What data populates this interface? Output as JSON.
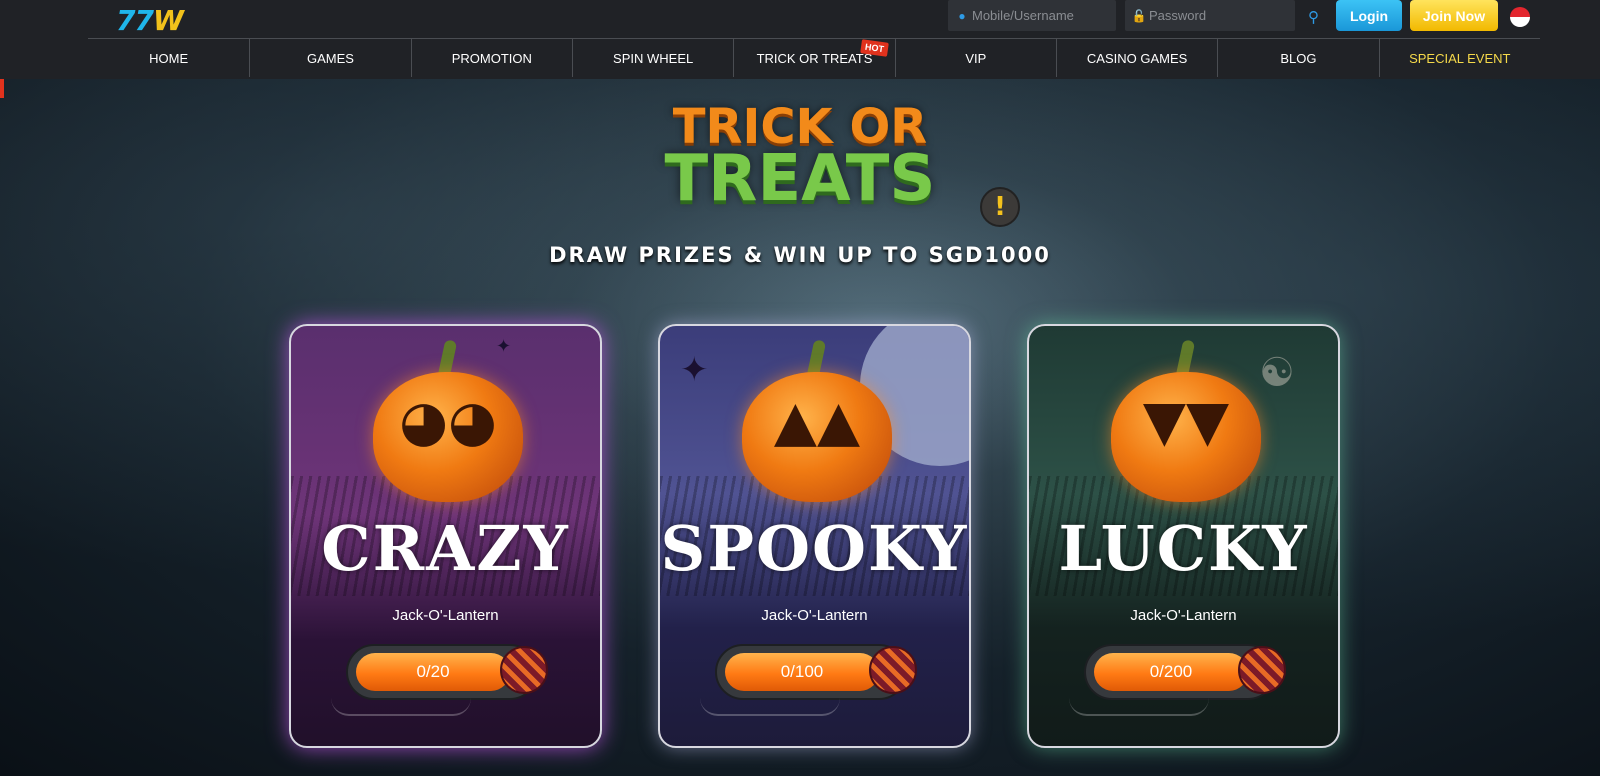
{
  "header": {
    "logo_main": "77",
    "logo_accent": "W",
    "username_placeholder": "Mobile/Username",
    "password_placeholder": "Password",
    "login_label": "Login",
    "join_label": "Join Now"
  },
  "nav": {
    "items": [
      "HOME",
      "GAMES",
      "PROMOTION",
      "SPIN WHEEL",
      "TRICK OR TREATS",
      "VIP",
      "CASINO GAMES",
      "BLOG",
      "SPECIAL EVENT"
    ],
    "hot_badge": "HOT"
  },
  "hero": {
    "title_line1": "TRICK OR",
    "title_line2": "TREATS",
    "subtitle": "DRAW PRIZES & WIN UP TO SGD1000"
  },
  "cards": [
    {
      "name": "CRAZY",
      "sub": "Jack-O'-Lantern",
      "progress": "0/20",
      "progress_value": 0,
      "progress_max": 20,
      "color": "#c458eb"
    },
    {
      "name": "SPOOKY",
      "sub": "Jack-O'-Lantern",
      "progress": "0/100",
      "progress_value": 0,
      "progress_max": 100,
      "color": "#bebef0"
    },
    {
      "name": "LUCKY",
      "sub": "Jack-O'-Lantern",
      "progress": "0/200",
      "progress_value": 0,
      "progress_max": 200,
      "color": "#6edcaa"
    }
  ],
  "icons": {
    "user": "user-icon",
    "lock": "lock-icon",
    "key": "key-icon",
    "flag": "singapore-flag-icon",
    "info": "exclamation-icon",
    "candy": "candy-icon"
  },
  "colors": {
    "header_bg": "#202226",
    "login": "#1fa8e6",
    "join": "#f5c21d",
    "special_event": "#f5d94a",
    "progress": "#ff7a14"
  }
}
